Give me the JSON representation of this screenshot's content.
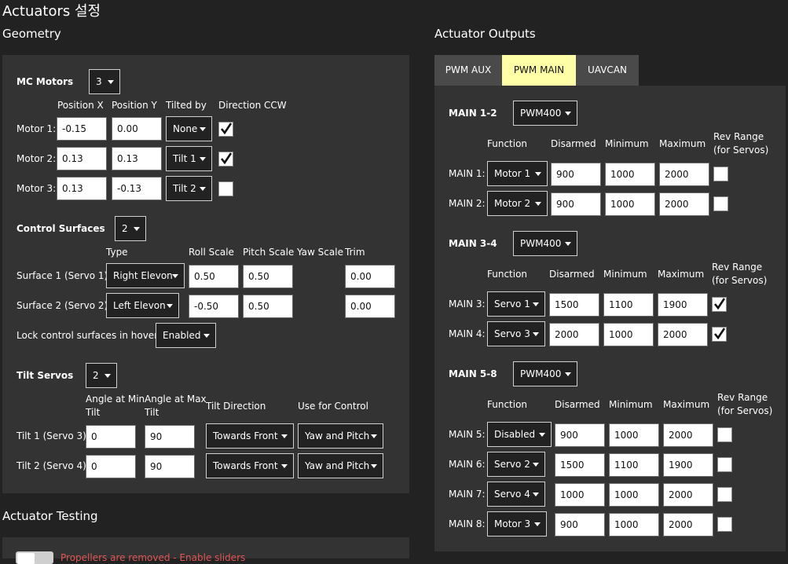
{
  "title": "Actuators 설정",
  "geometry": {
    "heading": "Geometry",
    "motors": {
      "label": "MC Motors",
      "count": "3",
      "headers": [
        "Position X",
        "Position Y",
        "Tilted by",
        "Direction CCW"
      ],
      "rows": [
        {
          "label": "Motor 1:",
          "x": "-0.15",
          "y": "0.00",
          "tilt": "None",
          "ccw": true
        },
        {
          "label": "Motor 2:",
          "x": "0.13",
          "y": "0.13",
          "tilt": "Tilt 1",
          "ccw": true
        },
        {
          "label": "Motor 3:",
          "x": "0.13",
          "y": "-0.13",
          "tilt": "Tilt 2",
          "ccw": false
        }
      ]
    },
    "surfaces": {
      "label": "Control Surfaces",
      "count": "2",
      "headers": [
        "Type",
        "Roll Scale",
        "Pitch Scale",
        "Yaw Scale",
        "Trim"
      ],
      "rows": [
        {
          "label": "Surface 1 (Servo 1):",
          "type": "Right Elevon",
          "roll": "0.50",
          "pitch": "0.50",
          "trim": "0.00"
        },
        {
          "label": "Surface 2 (Servo 2):",
          "type": "Left Elevon",
          "roll": "-0.50",
          "pitch": "0.50",
          "trim": "0.00"
        }
      ],
      "lock_label": "Lock control surfaces in hover:",
      "lock_value": "Enabled"
    },
    "tilt": {
      "label": "Tilt Servos",
      "count": "2",
      "headers": [
        "Angle at Min",
        "Tilt",
        "Angle at Max",
        "Tilt",
        "Tilt Direction",
        "Use for Control"
      ],
      "rows": [
        {
          "label": "Tilt 1 (Servo 3):",
          "min": "0",
          "max": "90",
          "dir": "Towards Front",
          "ctrl": "Yaw and Pitch"
        },
        {
          "label": "Tilt 2 (Servo 4):",
          "min": "0",
          "max": "90",
          "dir": "Towards Front",
          "ctrl": "Yaw and Pitch"
        }
      ]
    }
  },
  "testing": {
    "heading": "Actuator Testing",
    "warning": "Propellers are removed - Enable sliders"
  },
  "outputs": {
    "heading": "Actuator Outputs",
    "tabs": [
      "PWM AUX",
      "PWM MAIN",
      "UAVCAN"
    ],
    "active_tab": "PWM MAIN",
    "headers": [
      "Function",
      "Disarmed",
      "Minimum",
      "Maximum",
      "Rev Range",
      "(for Servos)"
    ],
    "groups": [
      {
        "label": "MAIN 1-2",
        "rate": "PWM400",
        "rows": [
          {
            "label": "MAIN 1:",
            "func": "Motor 1",
            "disarmed": "900",
            "min": "1000",
            "max": "2000",
            "rev": false
          },
          {
            "label": "MAIN 2:",
            "func": "Motor 2",
            "disarmed": "900",
            "min": "1000",
            "max": "2000",
            "rev": false
          }
        ]
      },
      {
        "label": "MAIN 3-4",
        "rate": "PWM400",
        "rows": [
          {
            "label": "MAIN 3:",
            "func": "Servo 1",
            "disarmed": "1500",
            "min": "1100",
            "max": "1900",
            "rev": true
          },
          {
            "label": "MAIN 4:",
            "func": "Servo 3",
            "disarmed": "2000",
            "min": "1000",
            "max": "2000",
            "rev": true
          }
        ]
      },
      {
        "label": "MAIN 5-8",
        "rate": "PWM400",
        "rows": [
          {
            "label": "MAIN 5:",
            "func": "Disabled",
            "disarmed": "900",
            "min": "1000",
            "max": "2000",
            "rev": false
          },
          {
            "label": "MAIN 6:",
            "func": "Servo 2",
            "disarmed": "1500",
            "min": "1100",
            "max": "1900",
            "rev": false
          },
          {
            "label": "MAIN 7:",
            "func": "Servo 4",
            "disarmed": "1000",
            "min": "1000",
            "max": "2000",
            "rev": false
          },
          {
            "label": "MAIN 8:",
            "func": "Motor 3",
            "disarmed": "900",
            "min": "1000",
            "max": "2000",
            "rev": false
          }
        ]
      }
    ]
  },
  "colors": {
    "background": "#222222",
    "panel": "#333333",
    "tab": "#4a4a4a",
    "active_tab": "#ffffa8",
    "warning": "#e05757"
  }
}
